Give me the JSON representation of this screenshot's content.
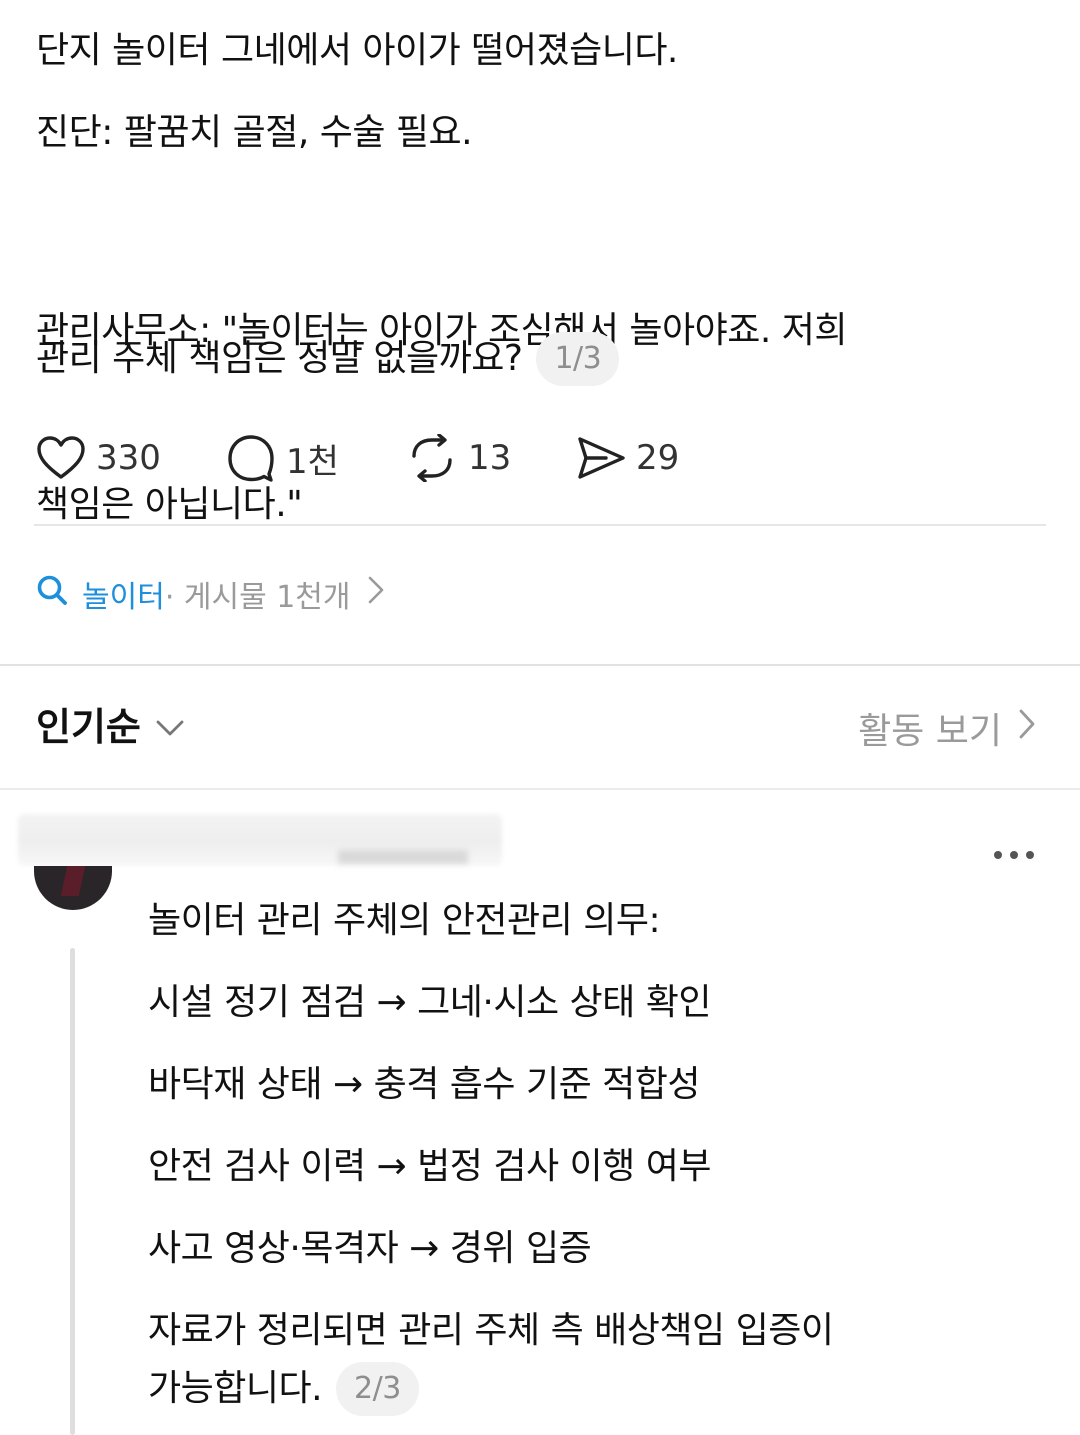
{
  "post": {
    "line1": "단지 놀이터 그네에서 아이가 떨어졌습니다.",
    "line2": "진단: 팔꿈치 골절, 수술 필요.",
    "line3a": "관리사무소: \"놀이터는 아이가 조심해서 놀아야죠. 저희",
    "line3b": "책임은 아닙니다.\"",
    "line4": "관리 주체 책임은 정말 없을까요?",
    "page_indicator": "1/3"
  },
  "actions": {
    "like_count": "330",
    "reply_count": "1천",
    "repost_count": "13",
    "share_count": "29"
  },
  "topic": {
    "name": "놀이터",
    "meta": " · 게시물 1천개"
  },
  "sort": {
    "label": "인기순",
    "activity_label": "활동 보기"
  },
  "reply": {
    "line1": "놀이터 관리 주체의 안전관리 의무:",
    "line2": "시설 정기 점검 → 그네·시소 상태 확인",
    "line3": "바닥재 상태 → 충격 흡수 기준 적합성",
    "line4": "안전 검사 이력 → 법정 검사 이행 여부",
    "line5": "사고 영상·목격자 → 경위 입증",
    "line6": "자료가 정리되면 관리 주체 측 배상책임 입증이",
    "line7": "가능합니다.",
    "page_indicator": "2/3"
  },
  "icons": {
    "like": "heart-icon",
    "reply": "speech-bubble-icon",
    "repost": "repost-arrows-icon",
    "share": "send-paper-plane-icon",
    "search": "search-icon",
    "chevron_right": "chevron-right-icon",
    "chevron_down": "chevron-down-icon",
    "more": "more-dots-icon"
  },
  "colors": {
    "topic_accent": "#1d8fdb",
    "muted_text": "#9a9a9a"
  }
}
